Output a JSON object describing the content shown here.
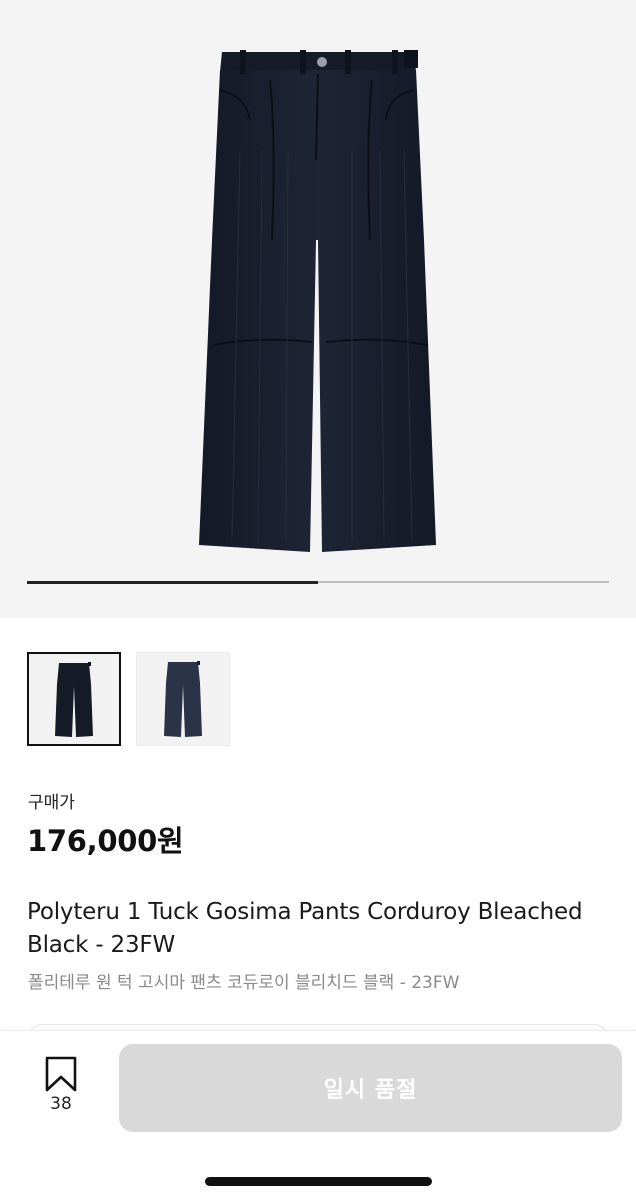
{
  "colors": {
    "hero_background": "#f4f4f4",
    "pants_primary": "#1b2130",
    "pants_secondary": "#2a3347",
    "progress_track": "#bdbdbd",
    "progress_fill": "#222222",
    "price_text": "#111111",
    "subtitle_text": "#8a8a8a",
    "button_disabled_bg": "#d9d9d9",
    "button_text": "#ffffff"
  },
  "gallery": {
    "image_count": 2,
    "active_index": 1,
    "progress_fraction": 0.5
  },
  "product": {
    "price_label": "구매가",
    "price": "176,000원",
    "title_en": "Polyteru 1 Tuck Gosima Pants Corduroy Bleached Black - 23FW",
    "title_ko": "폴리테루 원 턱 고시마 팬츠 코듀로이 블리치드 블랙 - 23FW"
  },
  "bottom_bar": {
    "bookmark_icon": "bookmark-icon",
    "bookmark_count": "38",
    "buy_button_label": "일시 품절"
  }
}
